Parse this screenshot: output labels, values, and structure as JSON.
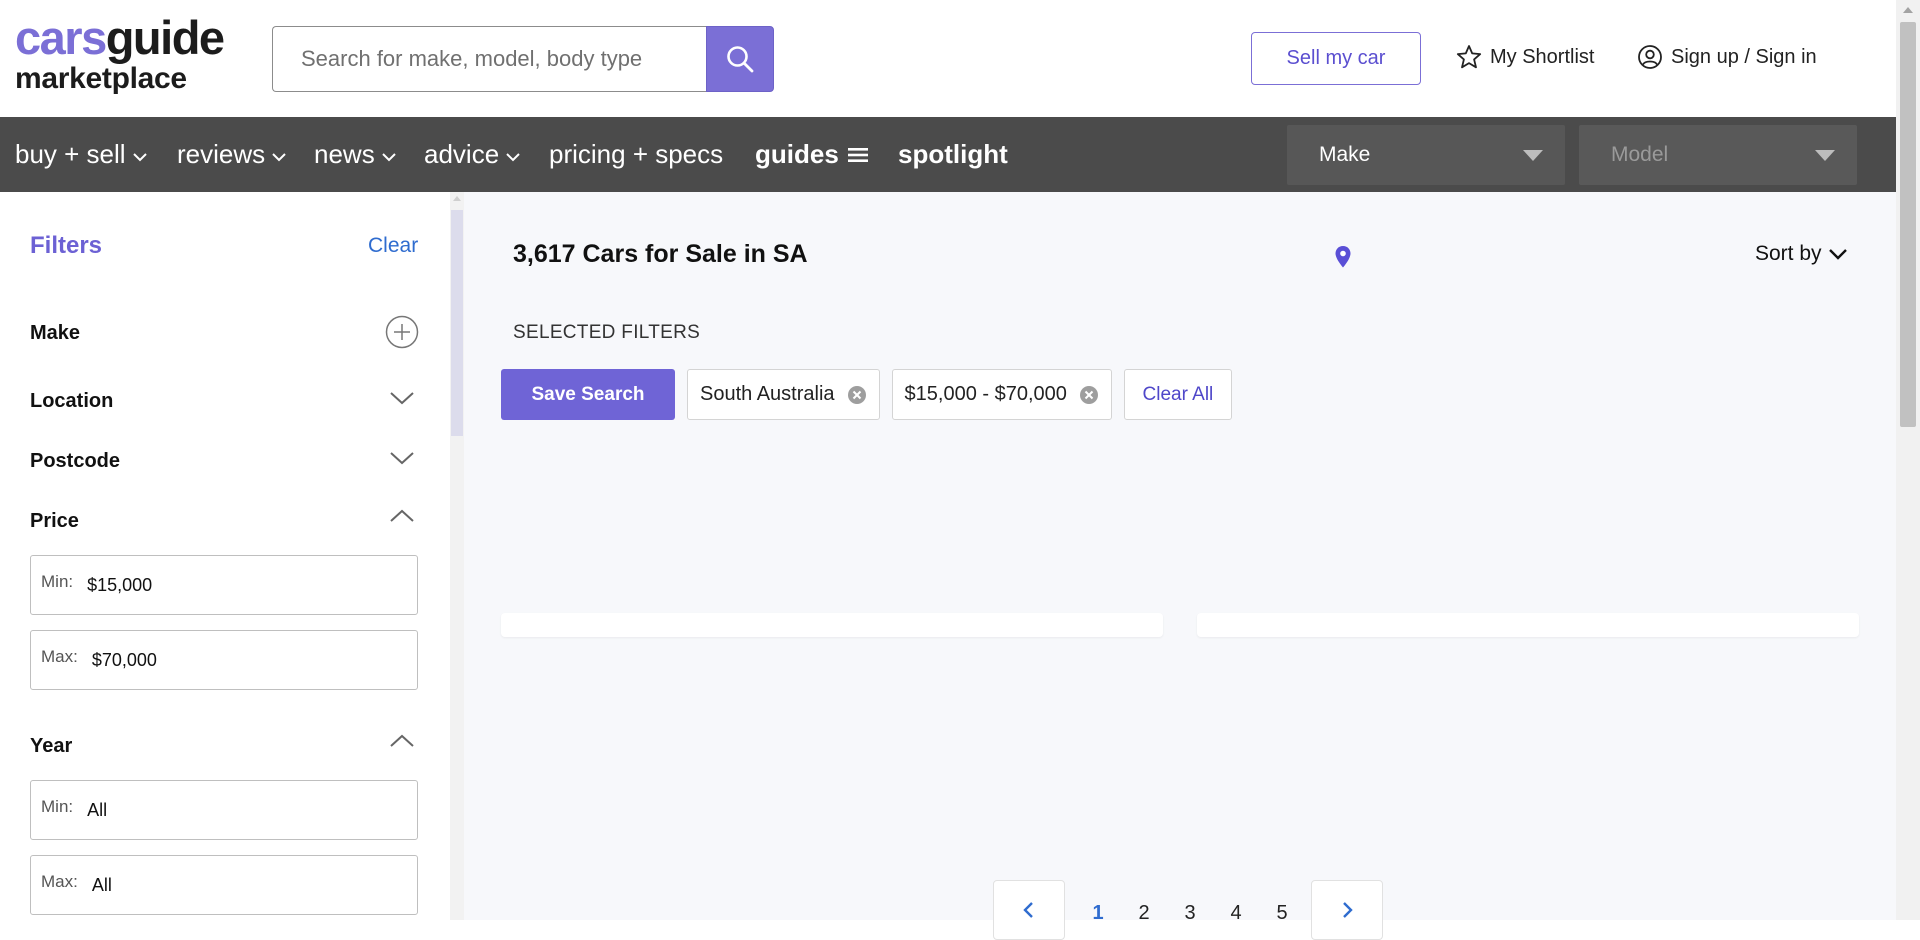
{
  "logo": {
    "part1": "cars",
    "part2": "guide",
    "line2": "marketplace"
  },
  "search": {
    "placeholder": "Search for make, model, body type",
    "value": ""
  },
  "header": {
    "sell_label": "Sell my car",
    "shortlist_label": "My Shortlist",
    "signin_label": "Sign up / Sign in"
  },
  "nav": {
    "items": [
      {
        "label": "buy + sell"
      },
      {
        "label": "reviews"
      },
      {
        "label": "news"
      },
      {
        "label": "advice"
      },
      {
        "label": "pricing + specs"
      },
      {
        "label": "guides"
      },
      {
        "label": "spotlight"
      }
    ],
    "make_select": "Make",
    "model_select": "Model"
  },
  "filters": {
    "title": "Filters",
    "clear_label": "Clear",
    "make_label": "Make",
    "location_label": "Location",
    "postcode_label": "Postcode",
    "price_label": "Price",
    "price_min_key": "Min:",
    "price_min": "$15,000",
    "price_max_key": "Max:",
    "price_max": "$70,000",
    "year_label": "Year",
    "year_min_key": "Min:",
    "year_min": "All",
    "year_max_key": "Max:",
    "year_max": "All"
  },
  "results": {
    "title": "3,617 Cars for Sale in SA",
    "sort_label": "Sort by",
    "selected_filters_label": "SELECTED FILTERS",
    "save_search_label": "Save Search",
    "chips": [
      "South Australia",
      "$15,000 - $70,000"
    ],
    "clear_all_label": "Clear All"
  },
  "pagination": {
    "pages": [
      "1",
      "2",
      "3",
      "4",
      "5"
    ],
    "current": "1"
  },
  "colors": {
    "brand": "#7b6fd6",
    "nav_bg": "#4b4b4b",
    "link": "#2f6ccf"
  }
}
